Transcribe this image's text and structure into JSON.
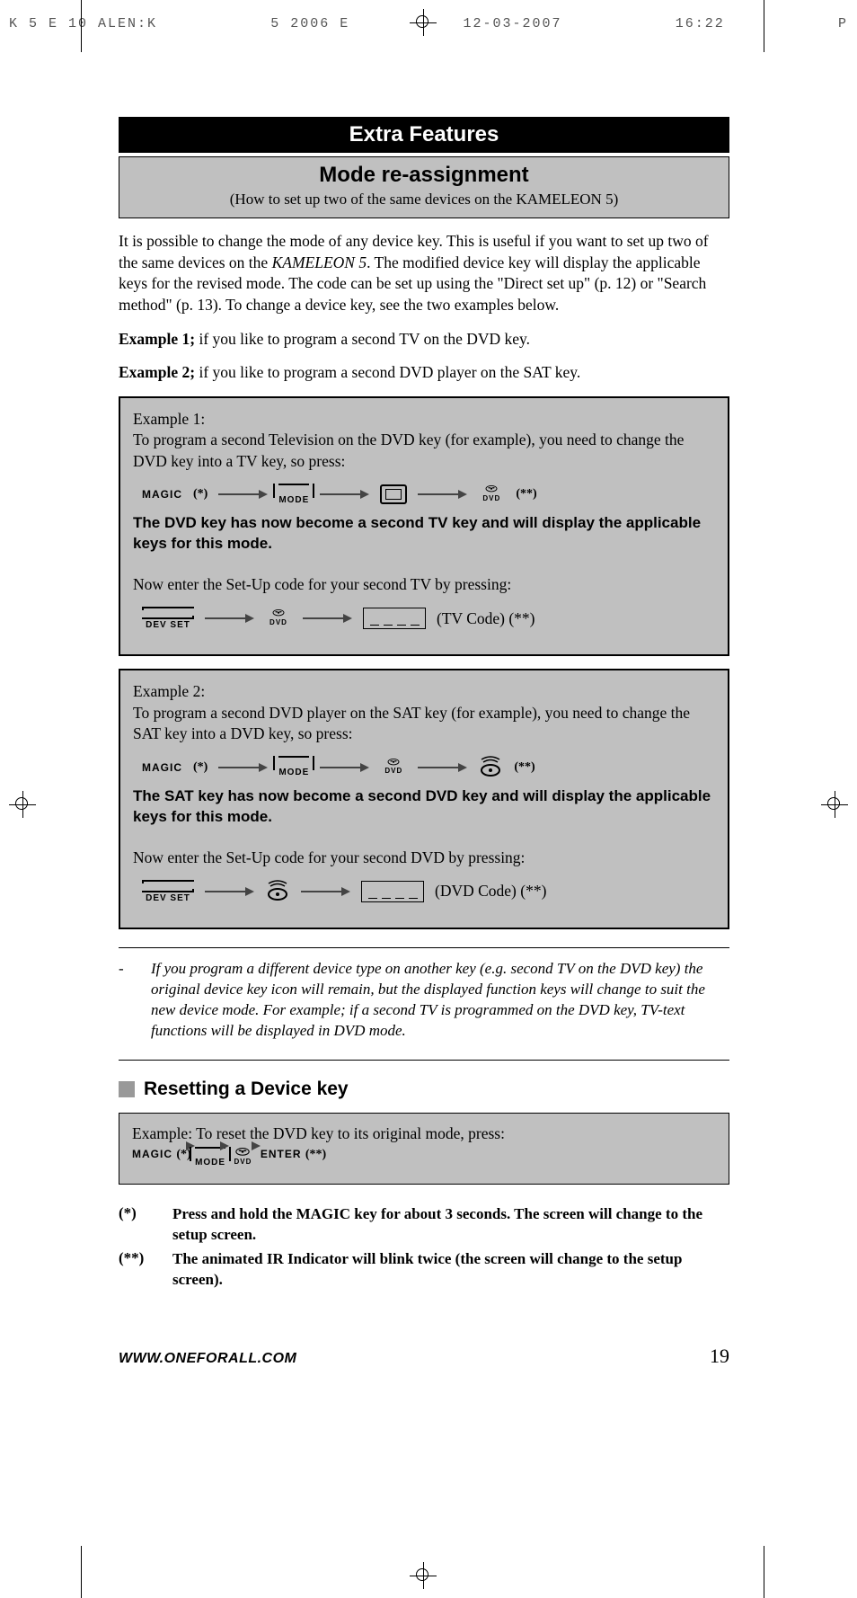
{
  "print_header": {
    "left": "K      5 E    10  ALEN:K",
    "mid": "5        2006 E",
    "date": "12-03-2007",
    "time": "16:22",
    "p": "P"
  },
  "black_bar": "Extra Features",
  "grey_bar": {
    "title": "Mode re-assignment",
    "sub_prefix": "(How to set up two of the same devices on the ",
    "sub_em": "KAMELEON 5",
    "sub_suffix": ")"
  },
  "intro": {
    "p1a": "It is possible to change the mode of any device key. This is useful if you want to set up two of the same devices on the ",
    "p1em": "KAMELEON 5",
    "p1b": ". The modified device key will display the applicable keys for the revised mode. The code can be set up using the \"Direct set up\" (p. 12) or \"Search method\" (p. 13). To change a device key, see the two examples below."
  },
  "ex_intro": {
    "e1_label": "Example 1;",
    "e1_text": " if you like to program a second TV on the DVD key.",
    "e2_label": "Example 2;",
    "e2_text": " if you like to program a second DVD player on the SAT key."
  },
  "box1": {
    "title": "Example 1:",
    "desc": "To program a second Television on the DVD key (for example), you need to change the DVD key into a TV key, so press:",
    "magic": "MAGIC",
    "mode": "MODE",
    "dvd": "DVD",
    "star1": "(*)",
    "star2": "(**)",
    "result": "The DVD key has now become a second TV key and will display the applicable keys for this mode.",
    "setup": "Now enter the Set-Up code for your second TV by pressing:",
    "devset": "DEV SET",
    "code_label": "(TV Code)  (**)"
  },
  "box2": {
    "title": "Example 2:",
    "desc": "To program a second DVD player on the SAT key (for example), you need to change the SAT key into a DVD key, so press:",
    "magic": "MAGIC",
    "mode": "MODE",
    "dvd": "DVD",
    "star1": "(*)",
    "star2": "(**)",
    "result": "The SAT key has now become a second DVD key and will display the applicable keys for this mode.",
    "setup": "Now enter the Set-Up code for your second DVD by pressing:",
    "devset": "DEV SET",
    "code_label": "(DVD Code) (**)"
  },
  "note": {
    "dash": "-",
    "text": "If you program a different device type on another key (e.g. second TV on the DVD key) the original device key icon will remain, but the displayed function keys will change to suit the new device mode. For example; if a second TV is programmed on the DVD key, TV-text functions will be displayed in DVD mode."
  },
  "reset": {
    "heading": "Resetting a Device key",
    "desc": "Example: To reset the DVD key to its original mode, press:",
    "magic": "MAGIC",
    "mode": "MODE",
    "dvd": "DVD",
    "enter": "ENTER",
    "star1": "(*)",
    "star2": "(**)"
  },
  "footnotes": {
    "m1": "(*)",
    "t1": "Press and hold the MAGIC key for about 3 seconds. The screen will change to the setup screen.",
    "m2": "(**)",
    "t2": "The animated IR Indicator will blink twice (the screen will change to the setup screen)."
  },
  "footer": {
    "url": "WWW.ONEFORALL.COM",
    "page": "19"
  }
}
